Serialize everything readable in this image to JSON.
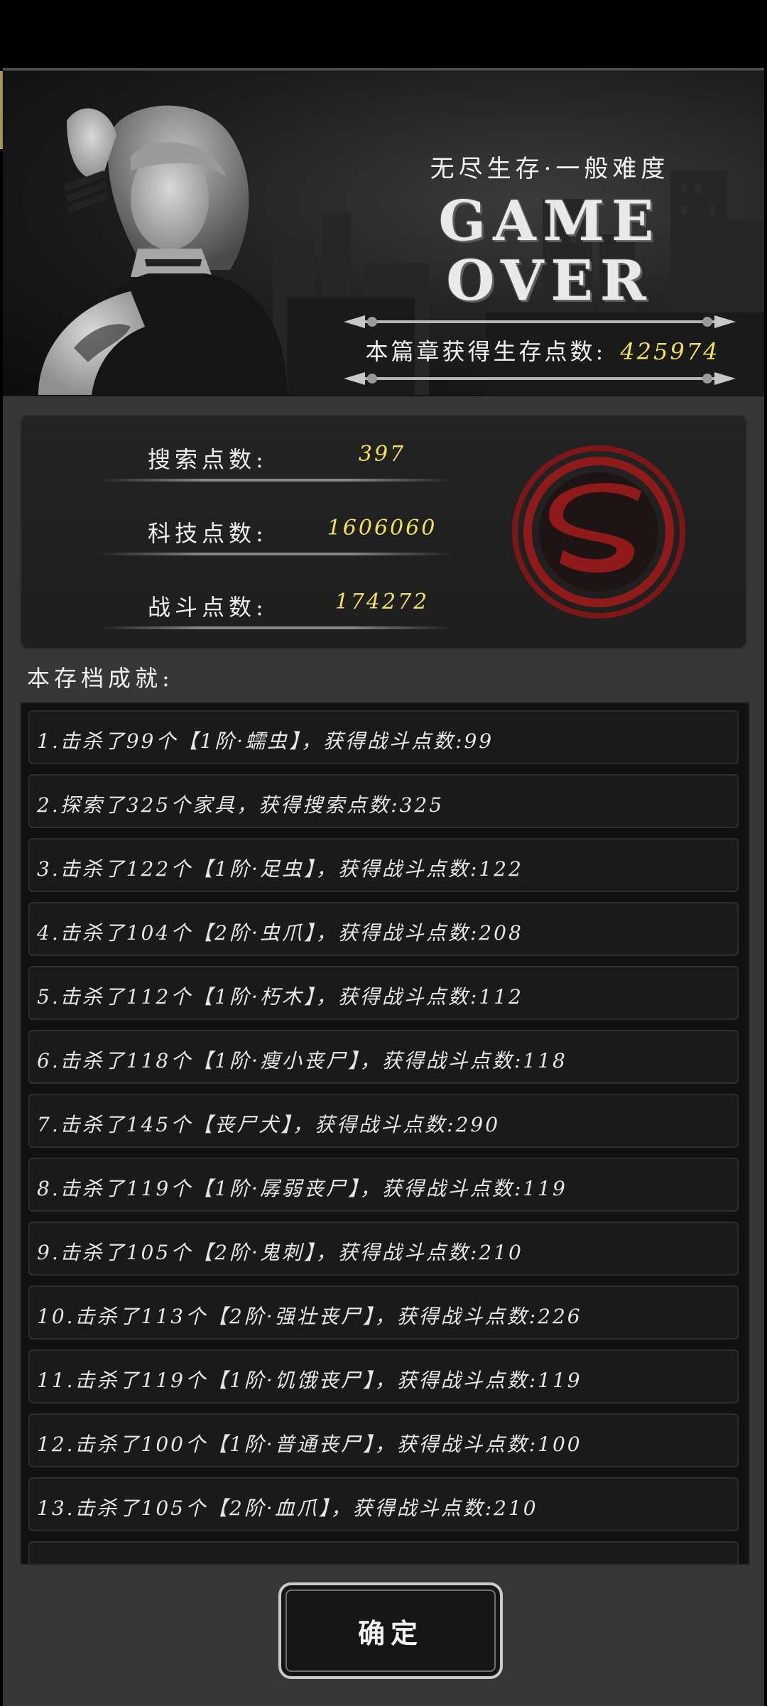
{
  "banner": {
    "subtitle": "无尽生存·一般难度",
    "title_line1": "GAME",
    "title_line2": "OVER",
    "chapter_points_label": "本篇章获得生存点数:",
    "chapter_points_value": "425974"
  },
  "points": [
    {
      "label": "搜索点数:",
      "value": "397"
    },
    {
      "label": "科技点数:",
      "value": "1606060"
    },
    {
      "label": "战斗点数:",
      "value": "174272"
    }
  ],
  "achievements_title": "本存档成就:",
  "achievements": [
    "1.击杀了99个【1阶·蠕虫】，获得战斗点数:99",
    "2.探索了325个家具，获得搜索点数:325",
    "3.击杀了122个【1阶·足虫】，获得战斗点数:122",
    "4.击杀了104个【2阶·虫爪】，获得战斗点数:208",
    "5.击杀了112个【1阶·朽木】，获得战斗点数:112",
    "6.击杀了118个【1阶·瘦小丧尸】，获得战斗点数:118",
    "7.击杀了145个【丧尸犬】，获得战斗点数:290",
    "8.击杀了119个【1阶·孱弱丧尸】，获得战斗点数:119",
    "9.击杀了105个【2阶·鬼刺】，获得战斗点数:210",
    "10.击杀了113个【2阶·强壮丧尸】，获得战斗点数:226",
    "11.击杀了119个【1阶·饥饿丧尸】，获得战斗点数:119",
    "12.击杀了100个【1阶·普通丧尸】，获得战斗点数:100",
    "13.击杀了105个【2阶·血爪】，获得战斗点数:210"
  ],
  "confirm_label": "确定",
  "colors": {
    "accent_yellow": "#f2e05c",
    "seal_red": "#8e1a1a",
    "tab_gold": "#b39d5c"
  },
  "icons": {
    "seal": "s-seal-icon",
    "portrait": "survivor-portrait"
  }
}
